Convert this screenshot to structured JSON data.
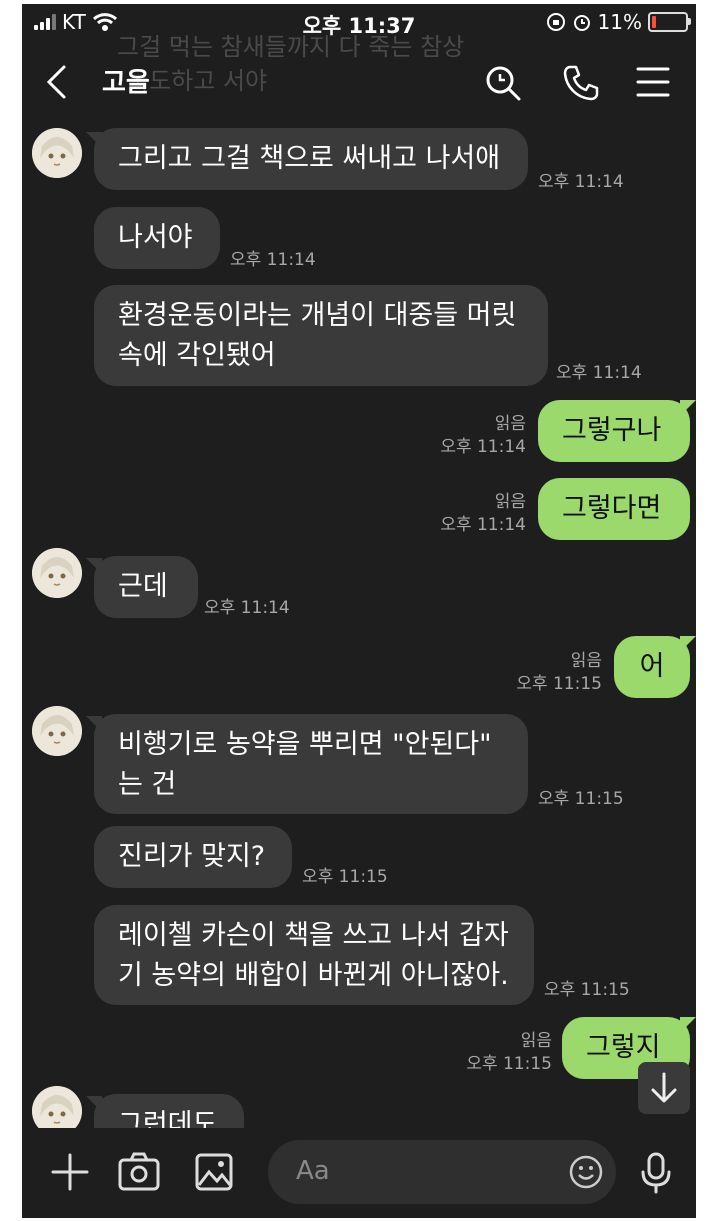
{
  "status_bar": {
    "carrier": "KT",
    "time": "오후 11:37",
    "battery": "11%",
    "battery_level": 0.11
  },
  "background_ghost": {
    "line1": "그걸 먹는 참새들까지 다 죽는 참상",
    "line2": "국도하고 서야"
  },
  "header": {
    "title": "고을"
  },
  "messages": [
    {
      "from": "them",
      "text": "그리고 그걸 책으로 써내고 나서애",
      "time": "오후 11:14"
    },
    {
      "from": "them",
      "text": "나서야",
      "time": "오후 11:14"
    },
    {
      "from": "them",
      "text": "환경운동이라는 개념이 대중들 머릿\n속에 각인됐어",
      "time": "오후 11:14"
    },
    {
      "from": "me",
      "text": "그렇구나",
      "read": "읽음",
      "time": "오후 11:14"
    },
    {
      "from": "me",
      "text": "그렇다면",
      "read": "읽음",
      "time": "오후 11:14"
    },
    {
      "from": "them",
      "text": "근데",
      "time": "오후 11:14"
    },
    {
      "from": "me",
      "text": "어",
      "read": "읽음",
      "time": "오후 11:15"
    },
    {
      "from": "them",
      "text": "비행기로 농약을 뿌리면 \"안된다\"\n는 건",
      "time": "오후 11:15"
    },
    {
      "from": "them",
      "text": "진리가 맞지?",
      "time": "오후 11:15"
    },
    {
      "from": "them",
      "text": "레이첼 카슨이 책을 쓰고 나서 갑자\n기 농약의 배합이 바뀐게 아니잖아.",
      "time": "오후 11:15"
    },
    {
      "from": "me",
      "text": "그렇지",
      "read": "읽음",
      "time": "오후 11:15"
    },
    {
      "from": "them",
      "text": "그런데도",
      "time": ""
    }
  ],
  "input": {
    "placeholder": "Aa"
  },
  "colors": {
    "background": "#1e1e1e",
    "incoming_bubble": "#3a3a3a",
    "outgoing_bubble": "#9cd96d"
  }
}
